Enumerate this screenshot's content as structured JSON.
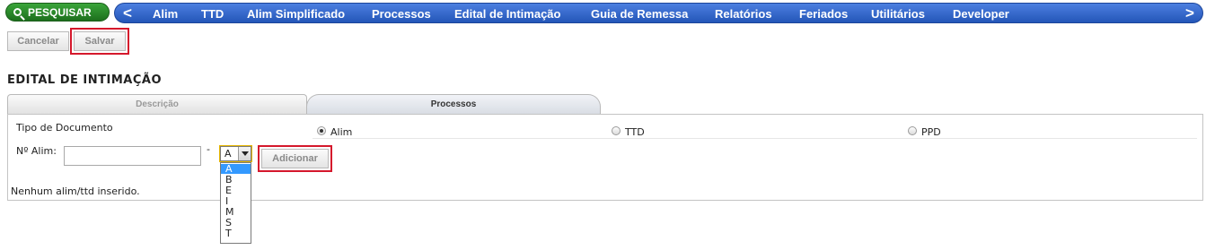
{
  "toolbar": {
    "search_label": "PESQUISAR"
  },
  "nav": {
    "prev_arrow": "<",
    "next_arrow": ">",
    "items": [
      "Alim",
      "TTD",
      "Alim Simplificado",
      "Processos",
      "Edital de Intimação",
      "Guia de Remessa",
      "Relatórios",
      "Feriados",
      "Utilitários",
      "Developer"
    ]
  },
  "actions": {
    "cancel_label": "Cancelar",
    "save_label": "Salvar"
  },
  "page": {
    "title": "EDITAL DE INTIMAÇÃO"
  },
  "tabs": [
    {
      "label": "Descrição"
    },
    {
      "label": "Processos"
    }
  ],
  "form": {
    "doc_type_label": "Tipo de Documento",
    "doc_types": [
      {
        "label": "Alim",
        "selected": true
      },
      {
        "label": "TTD",
        "selected": false
      },
      {
        "label": "PPD",
        "selected": false
      }
    ],
    "number_label": "Nº Alim:",
    "number_value": "",
    "dash": "-",
    "letter_selected": "A",
    "letter_options": [
      "A",
      "B",
      "E",
      "I",
      "M",
      "S",
      "T"
    ],
    "add_label": "Adicionar",
    "empty_message": "Nenhum alim/ttd inserido."
  },
  "colors": {
    "nav_blue": "#2f62c8",
    "search_green": "#2a8a2a",
    "highlight_red": "#d5182c",
    "select_highlight": "#3399ff"
  }
}
